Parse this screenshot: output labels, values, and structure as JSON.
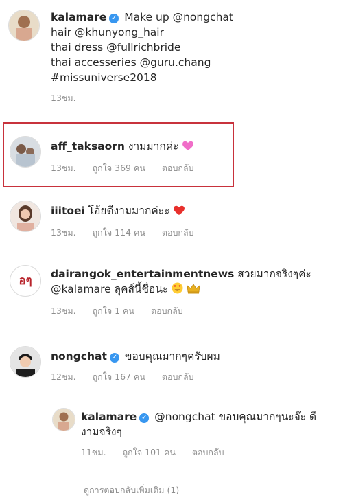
{
  "comments": [
    {
      "username": "kalamare",
      "lines": [
        "Make up @nongchat",
        "hair @khunyong_hair",
        "thai dress @fullrichbride",
        "thai accesseries @guru.chang",
        "#missuniverse2018"
      ],
      "time": "13ชม."
    },
    {
      "username": "aff_taksaorn",
      "text": "งามมากค่ะ",
      "time": "13ชม.",
      "likes": "ถูกใจ 369 คน",
      "reply": "ตอบกลับ"
    },
    {
      "username": "iiitoei",
      "text": "โอ้ยดีงามมากค่ะะ",
      "time": "13ชม.",
      "likes": "ถูกใจ 114 คน",
      "reply": "ตอบกลับ"
    },
    {
      "username": "dairangok_entertainmentnews",
      "text": "สวยมากจริงๆค่ะ",
      "line2": "@kalamare ลุคส์นี้ชื่อนะ",
      "time": "13ชม.",
      "likes": "ถูกใจ 1 คน",
      "reply": "ตอบกลับ",
      "avatar_text": "อๆ"
    },
    {
      "username": "nongchat",
      "text": "ขอบคุณมากๆครับผม",
      "time": "12ชม.",
      "likes": "ถูกใจ 167 คน",
      "reply": "ตอบกลับ"
    },
    {
      "username": "kalamare",
      "text": "@nongchat ขอบคุณมากๆนะจ๊ะ ดี",
      "line2": "งามจริงๆ",
      "time": "11ชม.",
      "likes": "ถูกใจ 101 คน",
      "reply": "ตอบกลับ"
    }
  ],
  "view_more": "ดูการตอบกลับเพิ่มเติม (1)",
  "colors": {
    "verified": "#3897f0",
    "highlight": "#c8323c",
    "meta": "#8e8e8e"
  }
}
